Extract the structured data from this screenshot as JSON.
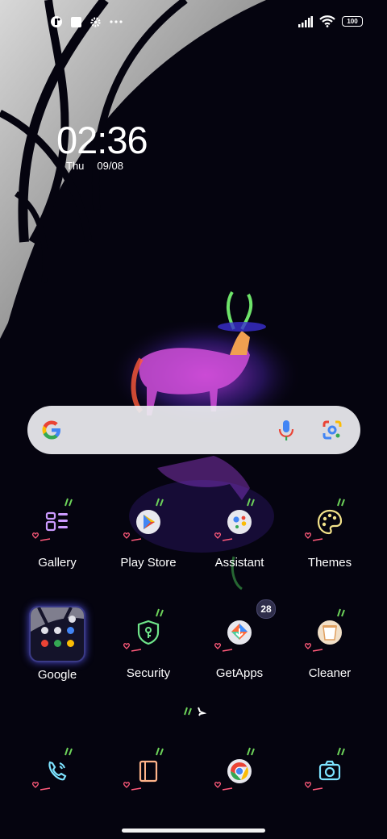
{
  "status_bar": {
    "left_icons": [
      "app-notification-icon",
      "square-notification-icon",
      "settings-notification-icon",
      "more-notifications-icon"
    ],
    "battery_level": "100",
    "right_icons": [
      "signal-icon",
      "wifi-icon",
      "battery-icon"
    ]
  },
  "clock": {
    "time": "02:36",
    "day": "Thu",
    "date": "09/08"
  },
  "search": {
    "icons": [
      "google-logo-icon",
      "microphone-icon",
      "lens-camera-icon"
    ]
  },
  "apps": {
    "row1": [
      {
        "label": "Gallery",
        "icon": "gallery-icon"
      },
      {
        "label": "Play Store",
        "icon": "play-store-icon"
      },
      {
        "label": "Assistant",
        "icon": "assistant-icon"
      },
      {
        "label": "Themes",
        "icon": "themes-palette-icon"
      }
    ],
    "row2": [
      {
        "label": "Google",
        "icon": "google-folder-icon"
      },
      {
        "label": "Security",
        "icon": "security-shield-icon"
      },
      {
        "label": "GetApps",
        "icon": "getapps-icon",
        "badge": "28"
      },
      {
        "label": "Cleaner",
        "icon": "cleaner-icon"
      }
    ]
  },
  "dock": [
    {
      "icon": "phone-icon"
    },
    {
      "icon": "notes-icon"
    },
    {
      "icon": "chrome-icon"
    },
    {
      "icon": "camera-icon"
    }
  ],
  "colors": {
    "background": "#05040f",
    "search_bar": "#ececf0",
    "neon_green": "#6dd35a",
    "neon_pink": "#ff5a7a",
    "neon_purple": "#b77bff"
  }
}
